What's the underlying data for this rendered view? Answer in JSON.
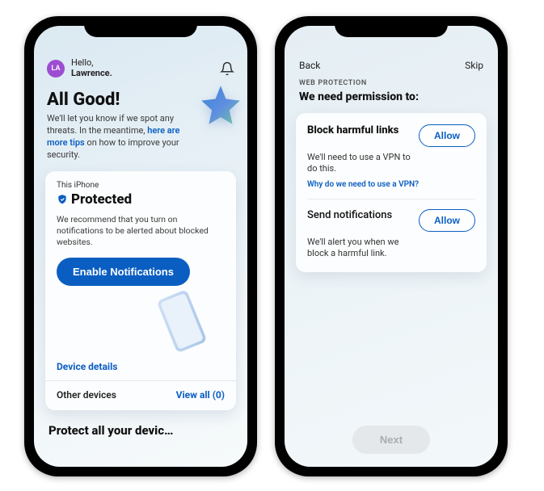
{
  "phone1": {
    "avatar_initials": "LA",
    "greeting_hello": "Hello,",
    "greeting_name": "Lawrence.",
    "title": "All Good!",
    "subtitle_before": "We'll let you know if we spot any threats. In the meantime, ",
    "subtitle_link": "here are more tips",
    "subtitle_after": " on how to improve your security.",
    "card": {
      "device_label": "This iPhone",
      "status": "Protected",
      "desc": "We recommend that you turn on notifications to be alerted about blocked websites.",
      "enable_btn": "Enable Notifications",
      "device_details": "Device details",
      "other_devices": "Other devices",
      "view_all": "View all (0)"
    },
    "bottom_teaser": "Protect all your devic…"
  },
  "phone2": {
    "nav_back": "Back",
    "nav_skip": "Skip",
    "section": "WEB PROTECTION",
    "heading": "We need permission to:",
    "perm1": {
      "title": "Block harmful links",
      "desc": "We'll need to use a VPN to do this.",
      "link": "Why do we need to use a VPN?",
      "allow": "Allow"
    },
    "perm2": {
      "title": "Send notifications",
      "desc": "We'll alert you when we block a harmful link.",
      "allow": "Allow"
    },
    "next": "Next"
  }
}
